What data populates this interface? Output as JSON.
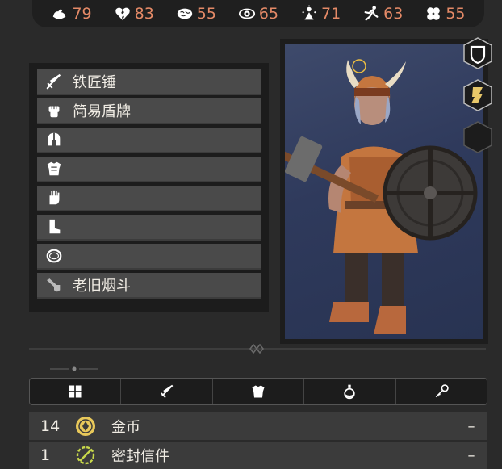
{
  "stats": [
    {
      "icon": "strength-icon",
      "value": "79"
    },
    {
      "icon": "broken-heart-icon",
      "value": "83"
    },
    {
      "icon": "brain-icon",
      "value": "55"
    },
    {
      "icon": "eye-icon",
      "value": "65"
    },
    {
      "icon": "spirit-icon",
      "value": "71"
    },
    {
      "icon": "agility-icon",
      "value": "63"
    },
    {
      "icon": "luck-clover-icon",
      "value": "55"
    }
  ],
  "equipment": [
    {
      "icon": "sword-icon",
      "label": "铁匠锤"
    },
    {
      "icon": "fist-icon",
      "label": "简易盾牌"
    },
    {
      "icon": "helmet-icon",
      "label": ""
    },
    {
      "icon": "armor-icon",
      "label": ""
    },
    {
      "icon": "glove-icon",
      "label": ""
    },
    {
      "icon": "boot-icon",
      "label": ""
    },
    {
      "icon": "ring-icon",
      "label": ""
    },
    {
      "icon": "pipe-icon",
      "label": "老旧烟斗"
    }
  ],
  "side_buttons": [
    {
      "icon": "shield-badge-icon"
    },
    {
      "icon": "scroll-badge-icon"
    },
    {
      "icon": "empty-badge-icon"
    }
  ],
  "tabs": [
    {
      "icon": "all-items-icon"
    },
    {
      "icon": "weapon-tab-icon"
    },
    {
      "icon": "armor-tab-icon"
    },
    {
      "icon": "potion-tab-icon"
    },
    {
      "icon": "key-tab-icon"
    }
  ],
  "inventory": [
    {
      "count": "14",
      "icon": "gold-coin-icon",
      "name": "金币",
      "action": "–"
    },
    {
      "count": "1",
      "icon": "sealed-letter-icon",
      "name": "密封信件",
      "action": "–"
    }
  ],
  "colors": {
    "stat_value": "#e58a67",
    "slot_bg": "#4a4a4a",
    "panel_bg": "#1c1c1c"
  }
}
